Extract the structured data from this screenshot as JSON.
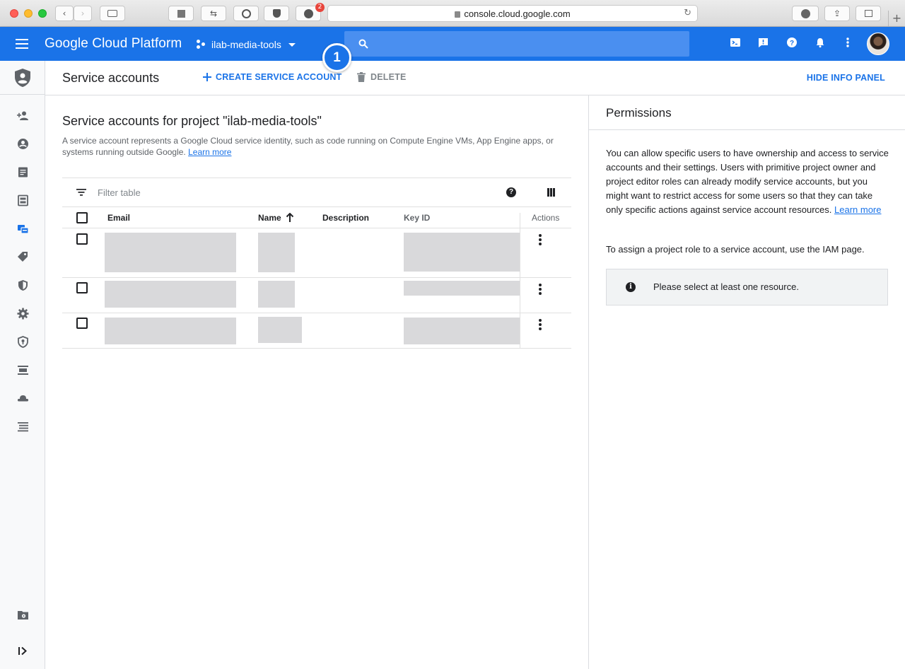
{
  "browser": {
    "url": "console.cloud.google.com",
    "extension_badge": "2"
  },
  "header": {
    "brand": "Google Cloud Platform",
    "project": "ilab-media-tools"
  },
  "step_badge": "1",
  "toolbar": {
    "title": "Service accounts",
    "create_label": "CREATE SERVICE ACCOUNT",
    "delete_label": "DELETE",
    "hide_info_label": "HIDE INFO PANEL"
  },
  "main": {
    "heading": "Service accounts for project \"ilab-media-tools\"",
    "description": "A service account represents a Google Cloud service identity, such as code running on Compute Engine VMs, App Engine apps, or systems running outside Google.",
    "learn_more": "Learn more"
  },
  "table": {
    "filter_placeholder": "Filter table",
    "columns": {
      "email": "Email",
      "name": "Name",
      "description": "Description",
      "key_id": "Key ID",
      "actions": "Actions"
    },
    "sort_icon": "arrow-up-icon"
  },
  "info_panel": {
    "title": "Permissions",
    "paragraph1": "You can allow specific users to have ownership and access to service accounts and their settings. Users with primitive project owner and project editor roles can already modify service accounts, but you might want to restrict access for some users so that they can take only specific actions against service account resources.",
    "learn_more": "Learn more",
    "paragraph2": "To assign a project role to a service account, use the IAM page.",
    "notice": "Please select at least one resource."
  },
  "colors": {
    "primary": "#1a73e8",
    "placeholder": "#d9d9db"
  }
}
